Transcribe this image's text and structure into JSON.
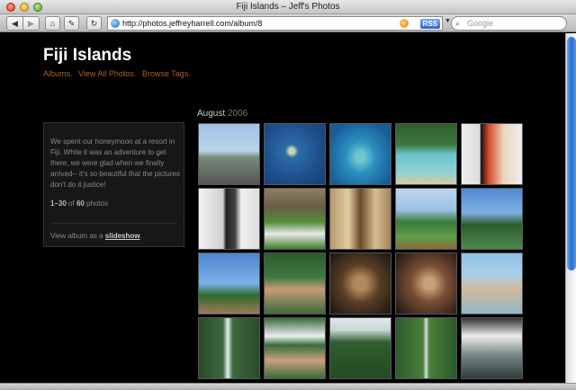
{
  "window": {
    "title": "Fiji Islands – Jeff's Photos"
  },
  "toolbar": {
    "back_glyph": "◀",
    "forward_glyph": "▶",
    "home_glyph": "⌂",
    "edit_glyph": "✎",
    "reload_glyph": "↻",
    "url": "http://photos.jeffreyharrell.com/album/8",
    "rss_label": "RSS",
    "search_placeholder": "Google",
    "search_glyph": "⌕"
  },
  "page": {
    "title": "Fiji Islands",
    "nav_links": [
      "Albums.",
      "View All Photos.",
      "Browse Tags."
    ],
    "description": "We spent our honeymoon at a resort in Fiji. While it was an adventure to get there, we were glad when we finally arrived-- it's so beautiful that the pictures don't do it justice!",
    "count_range": "1–30",
    "count_of": "of",
    "count_total": "60",
    "count_suffix": "photos",
    "slideshow_prefix": "View album as a",
    "slideshow_link": "slideshow",
    "slideshow_suffix": ".",
    "month": "August",
    "year": "2006"
  },
  "icons": [
    "globe-icon",
    "favicon-icon",
    "rss-badge",
    "search-icon",
    "home-icon",
    "edit-icon",
    "reload-icon"
  ],
  "colors": {
    "link_orange": "#a7612c",
    "background": "#000000",
    "sidebar_bg": "#171717"
  },
  "thumbnails": [
    {
      "name": "thumb-seaplane",
      "bg": "linear-gradient(#9fc3e6 0%, #b9d3ea 45%, #7a8a7a 55%, #555 100%)"
    },
    {
      "name": "thumb-aerial-islands",
      "bg": "radial-gradient(circle at 45% 45%, #c7d9a8 6%, #2d6da8 14%, #1d4f8a 60%, #183f74 100%)"
    },
    {
      "name": "thumb-reef",
      "bg": "radial-gradient(ellipse at 50% 55%, #6fc7d0 10%, #2b8fbf 35%, #1a5c99 80%)"
    },
    {
      "name": "thumb-beach",
      "bg": "linear-gradient(#2f5d2f 0%, #3d7a3d 35%, #6cc2c9 50%, #8ed2d3 80%, #d6c9a6 100%)"
    },
    {
      "name": "thumb-bure-interior",
      "bg": "linear-gradient(90deg, #eee 0%, #ddd 30%, #111 32%, #d94a2a 45%, #e8d8c0 70%, #eee 100%)"
    },
    {
      "name": "thumb-bathroom",
      "bg": "linear-gradient(90deg, #f2f2f2 0%, #cfcfcf 40%, #222 45%, #444 60%, #f0f0f0 70%, #ddd 100%)"
    },
    {
      "name": "thumb-poolside",
      "bg": "linear-gradient(#8e7f66 0%, #6a5d45 30%, #4f8e3a 55%, #e8e8e8 75%, #3e7e2e 100%)"
    },
    {
      "name": "thumb-room",
      "bg": "linear-gradient(90deg, #b89a6a 0%, #e0cba0 30%, #6b4a2c 50%, #d7bf93 75%, #a38357 100%)"
    },
    {
      "name": "thumb-palm-shore",
      "bg": "linear-gradient(#bcd6ee 0%, #9bc1e4 35%, #3a7c3a 55%, #5e9d4a 80%, #8b6b3a 100%)"
    },
    {
      "name": "thumb-palms-sky",
      "bg": "linear-gradient(#4f8ad1 0%, #7fb0e2 40%, #2c5c2c 60%, #4f8a4f 100%)"
    },
    {
      "name": "thumb-palm-selfie",
      "bg": "linear-gradient(#4d86cf 0%, #7ab1e9 50%, #2f6a2f 70%, #a07a5c 100%)"
    },
    {
      "name": "thumb-hammock",
      "bg": "linear-gradient(#2c5a2c 0%, #3f7a3f 40%, #c99a7a 60%, #3b6a3b 100%)"
    },
    {
      "name": "thumb-kava-1",
      "bg": "radial-gradient(circle at 50% 50%, #b08a5c 15%, #5a3e26 45%, #1c1410 100%)"
    },
    {
      "name": "thumb-kava-2",
      "bg": "radial-gradient(circle at 55% 50%, #c9a07a 12%, #7a5035 40%, #1c1410 100%)"
    },
    {
      "name": "thumb-shore-selfie",
      "bg": "linear-gradient(#8cc0e6 0%, #a9d0ea 35%, #d2b99c 60%, #8fb7c9 100%)"
    },
    {
      "name": "thumb-waterfall",
      "bg": "linear-gradient(90deg, #2a4a2a 0%, #3e6a3e 40%, #e8f0f0 48%, #3e6a3e 56%, #2a4a2a 100%)"
    },
    {
      "name": "thumb-waterfall-selfie",
      "bg": "linear-gradient(#3b6b3b 0%, #e8f0f0 30%, #3b6b3b 45%, #c9a07a 70%, #3b6b3b 100%)"
    },
    {
      "name": "thumb-rainforest",
      "bg": "linear-gradient(#dfe8ea 0%, #c8d6d6 20%, #2f5f2f 40%, #244a24 100%)"
    },
    {
      "name": "thumb-jungle",
      "bg": "linear-gradient(90deg, #2c5a2c 0%, #4a7e3a 45%, #d8e4e4 50%, #4a7e3a 55%, #2c5a2c 100%)"
    },
    {
      "name": "thumb-waterfall-pool",
      "bg": "linear-gradient(#333 0%, #ececec 30%, #7a8a8a 60%, #2d3d3d 100%)"
    }
  ]
}
